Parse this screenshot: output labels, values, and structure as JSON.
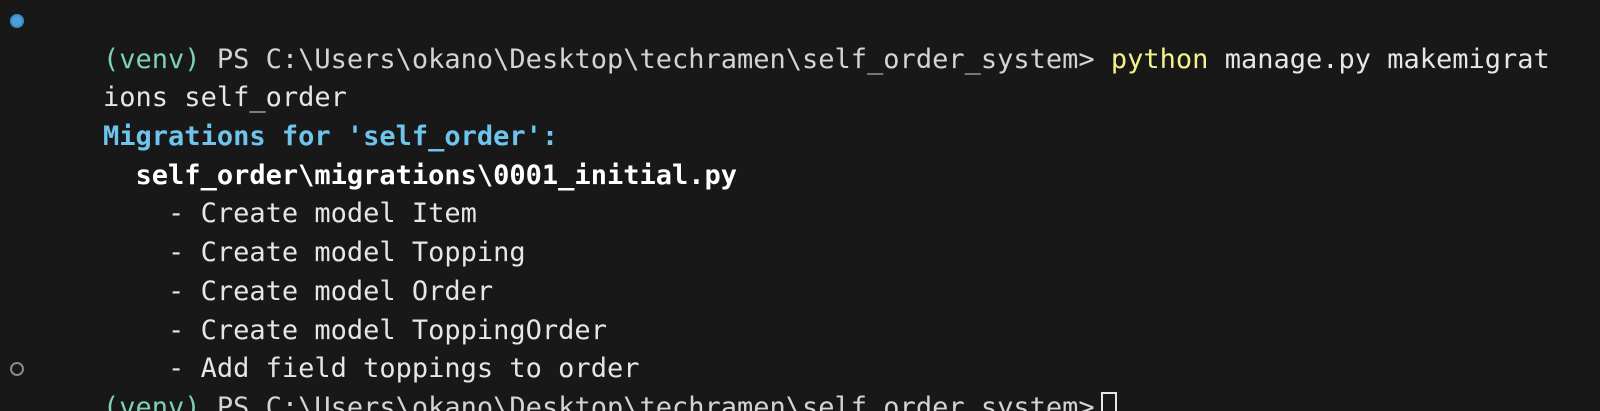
{
  "terminal": {
    "prompt1": {
      "venv": "(venv)",
      "ps": " PS C:\\Users\\okano\\Desktop\\techramen\\self_order_system> ",
      "command": "python",
      "args": " manage.py makemigrat"
    },
    "wrap_line": "ions self_order",
    "migrations_header": "Migrations for 'self_order':",
    "migration_file": "  self_order\\migrations\\0001_initial.py",
    "operations": [
      "    - Create model Item",
      "    - Create model Topping",
      "    - Create model Order",
      "    - Create model ToppingOrder",
      "    - Add field toppings to order"
    ],
    "prompt2": {
      "venv": "(venv)",
      "ps": " PS C:\\Users\\okano\\Desktop\\techramen\\self_order_system>"
    }
  },
  "colors": {
    "background": "#181818",
    "venv": "#7fd1b0",
    "command_keyword": "#f5f28a",
    "info_header": "#6fc4ec",
    "decoration_success": "#4aa0d8",
    "decoration_pending": "#8a8a8a"
  },
  "icons": {
    "decoration_success": "circle-filled-icon",
    "decoration_pending": "circle-outline-icon",
    "cursor": "block-cursor"
  }
}
